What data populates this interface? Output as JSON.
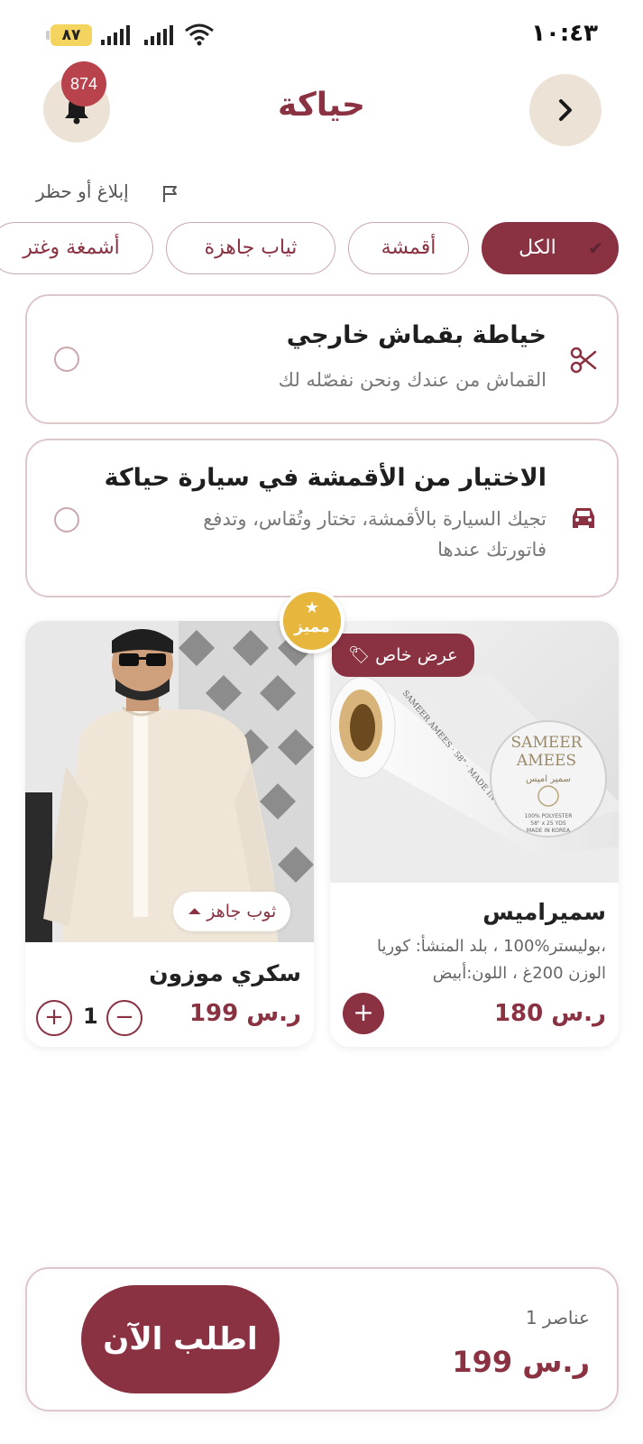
{
  "status_bar": {
    "time": "١٠:٤٣",
    "battery": "٨٧"
  },
  "header": {
    "title": "حياكة",
    "notification_count": "874"
  },
  "report_label": "إبلاغ أو حظر",
  "filters": {
    "items": [
      {
        "label": "الكل",
        "active": true
      },
      {
        "label": "أقمشة",
        "active": false
      },
      {
        "label": "ثياب جاهزة",
        "active": false
      },
      {
        "label": "أشمغة وغتر",
        "active": false
      }
    ]
  },
  "options": [
    {
      "title": "خياطة بقماش خارجي",
      "subtitle": "القماش من عندك ونحن نفصّله لك",
      "icon": "scissors-icon"
    },
    {
      "title": "الاختيار من الأقمشة في سيارة حياكة",
      "subtitle_line1": "تجيك السيارة بالأقمشة، تختار وتُقاس، وتدفع",
      "subtitle_line2": "فاتورتك عندها",
      "icon": "car-icon"
    }
  ],
  "featured_badge": "مميز",
  "products": [
    {
      "name": "سميراميس",
      "desc_line1": "بوليستر%100 ، بلد المنشأ: كوريا،",
      "desc_line2": "الوزن 200غ ، اللون:أبيض",
      "price": "180 ر.س",
      "tag": "عرض خاص",
      "image_text": {
        "brand_line1": "SAMEER",
        "brand_line2": "AMEES",
        "arabic": "سمير اميس",
        "spec1": "100% POLYESTER",
        "spec2": "58\" x 25 YDS",
        "spec3": "MADE IN KOREA",
        "edge_text": "SAMEER AMEES · 58\" · MADE IN KOREA"
      }
    },
    {
      "name": "سكري موزون",
      "price": "199 ر.س",
      "tag": "ثوب جاهز",
      "quantity": "1"
    }
  ],
  "cart": {
    "items_count": "1 عناصر",
    "total": "199 ر.س",
    "order_button": "اطلب الآن"
  },
  "colors": {
    "primary": "#8a3142",
    "beige": "#ece3d6",
    "gold": "#e7b63c",
    "badge_red": "#b8434d"
  }
}
